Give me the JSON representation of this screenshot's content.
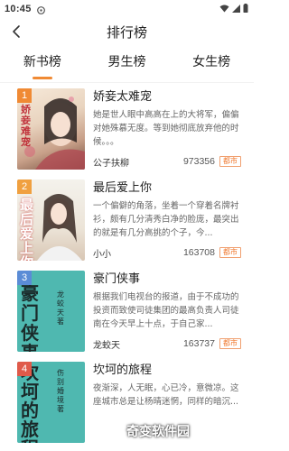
{
  "status": {
    "time": "10:45"
  },
  "header": {
    "title": "排行榜"
  },
  "tabs": [
    {
      "label": "新书榜",
      "active": true
    },
    {
      "label": "男生榜",
      "active": false
    },
    {
      "label": "女生榜",
      "active": false
    }
  ],
  "books": [
    {
      "rank": "1",
      "rank_color": "#f08a34",
      "cover_text": "娇妾难宠",
      "title": "娇妾太难宠",
      "desc": "她是世人眼中高高在上的大将军，偏偏对她殊慕无度。等到她彻底放弃他的时候。。。",
      "author": "公子扶柳",
      "count": "973356",
      "tag": "都市"
    },
    {
      "rank": "2",
      "rank_color": "#f0a040",
      "cover_text": "最后爱上你",
      "title": "最后爱上你",
      "desc": "一个偏僻的角落，坐着一个穿着名牌衬衫，颇有几分清秀白净的脸庞，最突出的就是有几分高挑的个子，今...",
      "author": "小小",
      "count": "163708",
      "tag": "都市"
    },
    {
      "rank": "3",
      "rank_color": "#5b8cd6",
      "cover_text": "豪门侠事",
      "cover_author": "龙蛟天 著",
      "title": "豪门侠事",
      "desc": "根据我们电视台的报道，由于不成功的投资而致使司徒集团的最高负责人司徒南在今天早上十点，于自己家...",
      "author": "龙蛟天",
      "count": "163737",
      "tag": "都市"
    },
    {
      "rank": "4",
      "rank_color": "#e05a4a",
      "cover_text": "坎坷的旅程",
      "cover_author": "伤别婚境 著",
      "title": "坎坷的旅程",
      "desc": "夜渐深，人无眠，心已冷，意微凉。这座城市总是让杨晴迷惘，同样的暗沉...",
      "author": "",
      "count": "",
      "tag": ""
    }
  ],
  "watermark": "奇变软件园"
}
